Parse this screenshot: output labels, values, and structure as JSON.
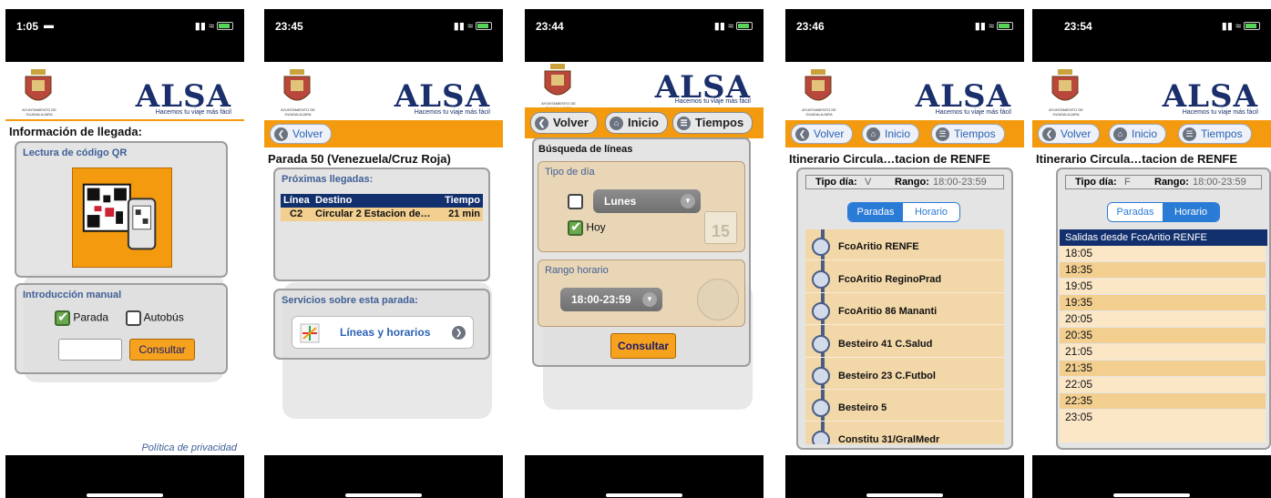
{
  "brand": {
    "name": "ALSA",
    "slogan": "Hacemos tu viaje más fácil",
    "crest_caption": "AYUNTAMIENTO DE GUADALAJARA"
  },
  "colors": {
    "orange": "#f39a0f",
    "navy": "#1a2f6b",
    "link_blue": "#2b61b5",
    "panel_head": "#3f5f96"
  },
  "nav": {
    "back": "Volver",
    "home": "Inicio",
    "times": "Tiempos"
  },
  "screen1": {
    "time": "1:05",
    "title": "Información de llegada:",
    "qr_head": "Lectura de código QR",
    "manual_head": "Introducción manual",
    "stop_label": "Parada",
    "bus_label": "Autobús",
    "input_value": "",
    "consult": "Consultar",
    "privacy": "Política de privacidad",
    "icons": {
      "car": "car-icon",
      "qr": "qr-code-phone-icon"
    }
  },
  "screen2": {
    "time": "23:45",
    "title": "Parada 50 (Venezuela/Cruz Roja)",
    "next_head": "Próximas llegadas:",
    "cols": [
      "Línea",
      "Destino",
      "Tiempo"
    ],
    "rows": [
      {
        "line": "C2",
        "dest": "Circular 2 Estacion de…",
        "time": "21 min"
      }
    ],
    "services_head": "Servicios sobre esta parada:",
    "lines_link": "Líneas y horarios"
  },
  "screen3": {
    "time": "23:44",
    "title": "Búsqueda de líneas",
    "day_type_head": "Tipo de día",
    "day_select": "Lunes",
    "today": "Hoy",
    "calendar_day": "15",
    "range_head": "Rango horario",
    "range_select": "18:00-23:59",
    "consult": "Consultar"
  },
  "screen4": {
    "time": "23:46",
    "title": "Itinerario Circula…tacion de RENFE",
    "day_type_label": "Tipo día:",
    "day_type_value": "V",
    "range_label": "Rango:",
    "range_value": "18:00-23:59",
    "tab_stops": "Paradas",
    "tab_schedule": "Horario",
    "stops": [
      "FcoAritio RENFE",
      "FcoAritio ReginoPrad",
      "FcoAritio 86 Mananti",
      "Besteiro 41 C.Salud",
      "Besteiro 23 C.Futbol",
      "Besteiro 5",
      "Constitu 31/GralMedr"
    ]
  },
  "screen5": {
    "time": "23:54",
    "title": "Itinerario Circula…tacion de RENFE",
    "day_type_label": "Tipo día:",
    "day_type_value": "F",
    "range_label": "Rango:",
    "range_value": "18:00-23:59",
    "tab_stops": "Paradas",
    "tab_schedule": "Horario",
    "departures_head": "Salidas desde FcoAritio RENFE",
    "times": [
      "18:05",
      "18:35",
      "19:05",
      "19:35",
      "20:05",
      "20:35",
      "21:05",
      "21:35",
      "22:05",
      "22:35",
      "23:05"
    ]
  }
}
